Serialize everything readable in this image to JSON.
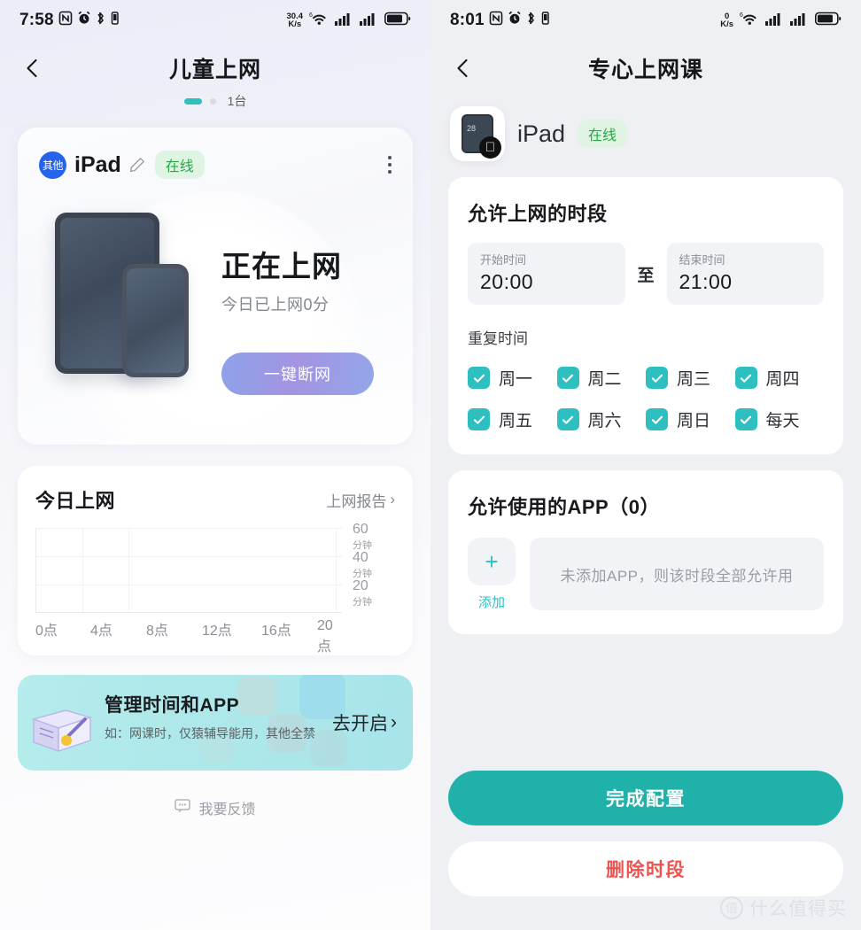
{
  "left": {
    "statusbar": {
      "time": "7:58",
      "icons": [
        "nfc-icon",
        "alarm-icon",
        "bluetooth-icon",
        "vibrate-icon"
      ],
      "net_speed_value": "30.4",
      "net_speed_unit": "K/s",
      "wifi_gen": "6",
      "right_icons": [
        "wifi-icon",
        "signal-icon",
        "signal-icon",
        "battery-icon"
      ]
    },
    "nav": {
      "back": "‹",
      "title": "儿童上网"
    },
    "pager": {
      "count_label": "1台",
      "active_index": 0,
      "total": 2
    },
    "device_card": {
      "type_badge": "其他",
      "name": "iPad",
      "edit_icon": "pencil-icon",
      "status_pill": "在线",
      "menu_icon": "more-vertical-icon",
      "status_title": "正在上网",
      "status_sub": "今日已上网0分",
      "disconnect_button": "一键断网"
    },
    "today_card": {
      "title": "今日上网",
      "report_link": "上网报告",
      "chevron": "›"
    },
    "promo": {
      "title": "管理时间和APP",
      "subtitle": "如：网课时，仅猿辅导能用，其他全禁",
      "cta": "去开启",
      "cta_chevron": "›"
    },
    "feedback": {
      "icon": "feedback-icon",
      "label": "我要反馈"
    }
  },
  "right": {
    "statusbar": {
      "time": "8:01",
      "net_speed_value": "0",
      "net_speed_unit": "K/s",
      "wifi_gen": "6"
    },
    "nav": {
      "back": "‹",
      "title": "专心上网课"
    },
    "device": {
      "icon": "ipad-icon",
      "icon_widget_temp": "28",
      "brand_badge": "apple-icon",
      "name": "iPad",
      "status_pill": "在线"
    },
    "schedule_card": {
      "title": "允许上网的时段",
      "start_label": "开始时间",
      "start_value": "20:00",
      "separator": "至",
      "end_label": "结束时间",
      "end_value": "21:00",
      "repeat_label": "重复时间",
      "days": [
        {
          "label": "周一",
          "checked": true
        },
        {
          "label": "周二",
          "checked": true
        },
        {
          "label": "周三",
          "checked": true
        },
        {
          "label": "周四",
          "checked": true
        },
        {
          "label": "周五",
          "checked": true
        },
        {
          "label": "周六",
          "checked": true
        },
        {
          "label": "周日",
          "checked": true
        },
        {
          "label": "每天",
          "checked": true
        }
      ]
    },
    "app_card": {
      "title": "允许使用的APP（0）",
      "add_icon": "plus-icon",
      "add_label": "添加",
      "empty_text": "未添加APP，则该时段全部允许用"
    },
    "actions": {
      "primary": "完成配置",
      "danger": "删除时段"
    },
    "watermark": {
      "mark": "值",
      "text": "什么值得买"
    }
  },
  "chart_data": {
    "type": "bar",
    "title": "今日上网",
    "xlabel": "",
    "ylabel": "分钟",
    "categories": [
      "0点",
      "4点",
      "8点",
      "12点",
      "16点",
      "20点"
    ],
    "values": [
      0,
      0,
      0,
      0,
      0,
      0
    ],
    "yticks": [
      {
        "value": "60",
        "unit": "分钟"
      },
      {
        "value": "40",
        "unit": "分钟"
      },
      {
        "value": "20",
        "unit": "分钟"
      }
    ],
    "ylim": [
      0,
      60
    ],
    "grid": true,
    "legend": "none"
  },
  "colors": {
    "teal_accent": "#20b2aa",
    "checkbox_teal": "#2ec0c0",
    "online_green": "#28a745",
    "danger_red": "#ef5350",
    "badge_blue": "#2563eb",
    "promo_bg": "#aee8ea",
    "right_bg": "#eff0f4"
  }
}
